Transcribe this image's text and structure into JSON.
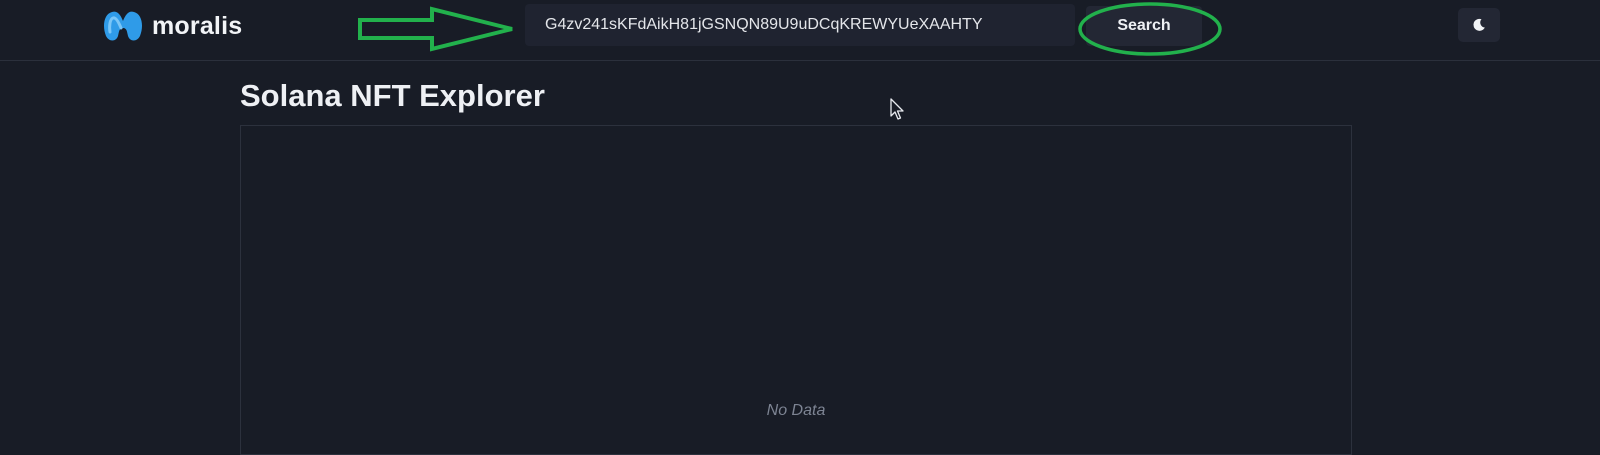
{
  "header": {
    "brand_name": "moralis",
    "search": {
      "value": "G4zv241sKFdAikH81jGSNQN89U9uDCqKREWYUeXAAHTY",
      "placeholder": ""
    },
    "search_button_label": "Search",
    "theme_toggle_icon": "moon-icon",
    "annotation_color": "#22b14c"
  },
  "main": {
    "title": "Solana NFT Explorer",
    "empty_state": "No Data"
  },
  "colors": {
    "background": "#181c26",
    "logo_blue": "#2f9be8"
  }
}
